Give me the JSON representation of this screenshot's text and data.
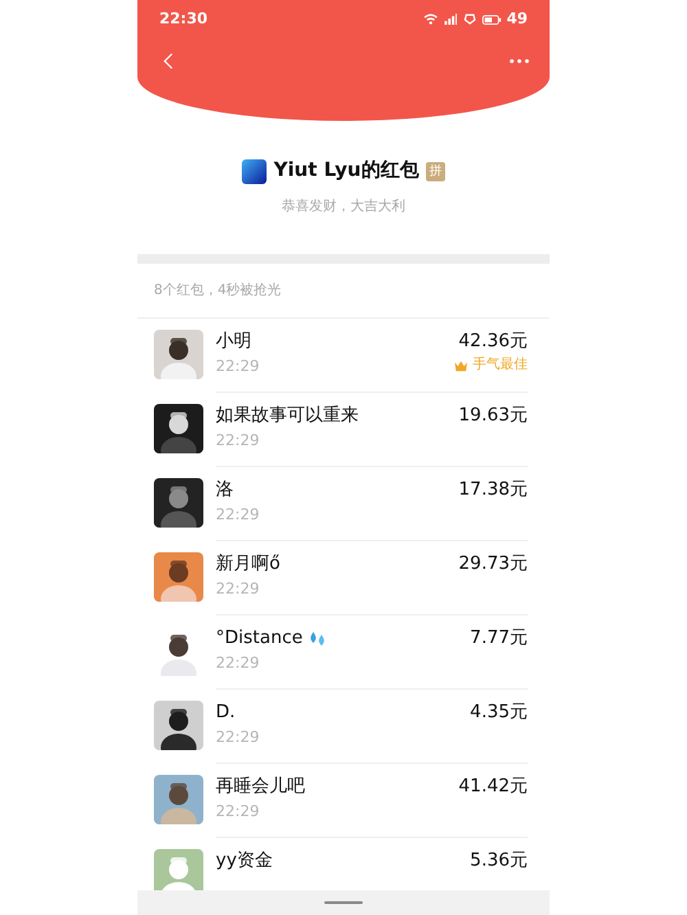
{
  "status_bar": {
    "time": "22:30",
    "battery": "49"
  },
  "header": {
    "title": "Yiut Lyu的红包",
    "badge": "拼",
    "subtitle": "恭喜发财，大吉大利"
  },
  "summary": "8个红包，4秒被抢光",
  "rows": [
    {
      "name": "小明",
      "time": "22:29",
      "amount": "42.36元",
      "best": true,
      "best_label": "手气最佳"
    },
    {
      "name": "如果故事可以重来",
      "time": "22:29",
      "amount": "19.63元",
      "best": false
    },
    {
      "name": "洛",
      "time": "22:29",
      "amount": "17.38元",
      "best": false
    },
    {
      "name": "新月啊ő",
      "time": "22:29",
      "amount": "29.73元",
      "best": false
    },
    {
      "name": "°Distance",
      "emoji": true,
      "time": "22:29",
      "amount": "7.77元",
      "best": false
    },
    {
      "name": "D.",
      "time": "22:29",
      "amount": "4.35元",
      "best": false
    },
    {
      "name": "再睡会儿吧",
      "time": "22:29",
      "amount": "41.42元",
      "best": false
    },
    {
      "name": "yy资金",
      "amount": "5.36元",
      "best": false
    }
  ]
}
